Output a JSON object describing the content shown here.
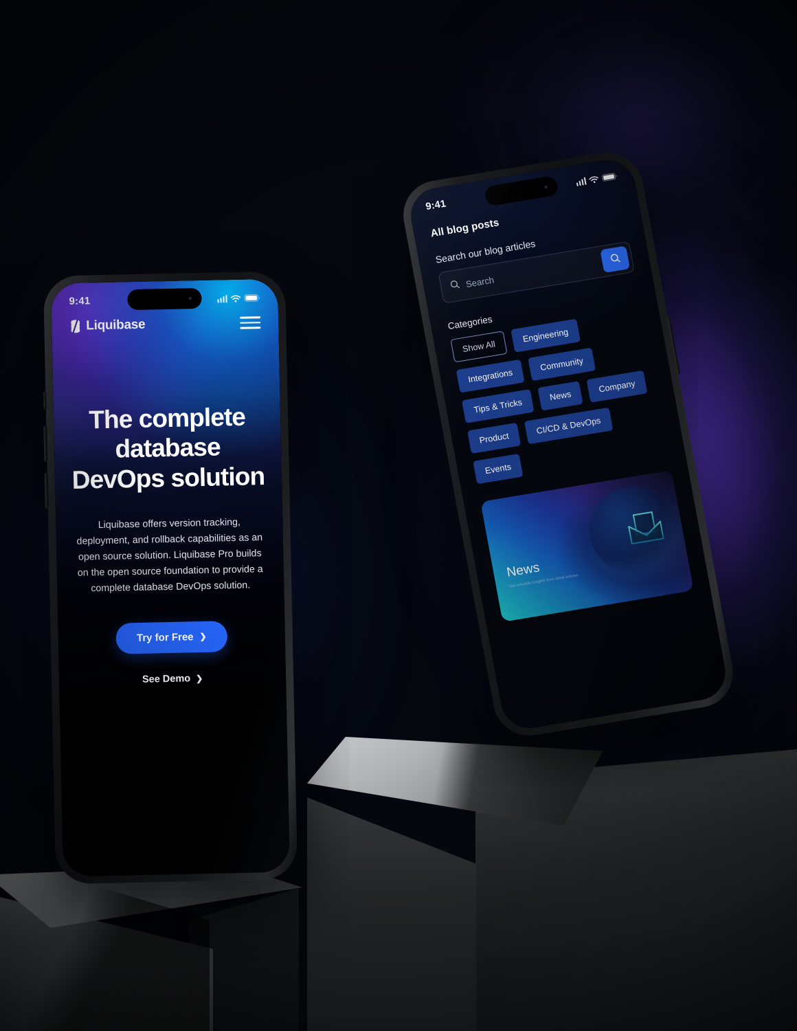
{
  "scene": {
    "background_color": "#05080f",
    "accent_purple": "#6e46e1",
    "accent_blue": "#2563f3"
  },
  "left_phone": {
    "status_bar": {
      "time": "9:41",
      "signal_icon": "cellular-signal-icon",
      "wifi_icon": "wifi-icon",
      "battery_icon": "battery-icon"
    },
    "header": {
      "logo_mark": "liquibase-logo-mark",
      "logo_text": "Liquibase",
      "menu_icon": "hamburger-menu-icon"
    },
    "hero": {
      "title": "The complete database DevOps solution",
      "body": "Liquibase offers version tracking, deployment, and rollback capabilities as an open source solution. Liquibase Pro builds on the open source foundation to provide a complete database DevOps solution.",
      "primary_cta": "Try for Free",
      "primary_cta_chevron": "chevron-right-icon",
      "secondary_cta": "See Demo",
      "secondary_cta_chevron": "chevron-right-icon",
      "gradient_from": "#4a20b4",
      "gradient_to": "#00b2eb"
    }
  },
  "right_phone": {
    "status_bar": {
      "time": "9:41",
      "signal_icon": "cellular-signal-icon",
      "wifi_icon": "wifi-icon",
      "battery_icon": "battery-icon"
    },
    "blog": {
      "page_title": "All blog posts",
      "search_label": "Search our blog articles",
      "search_placeholder": "Search",
      "search_value": "",
      "search_field_icon": "search-icon",
      "search_button_icon": "search-icon",
      "search_button_color": "#2b6bf5",
      "categories_label": "Categories",
      "categories": [
        {
          "label": "Show All",
          "style": "outline"
        },
        {
          "label": "Engineering",
          "style": "filled"
        },
        {
          "label": "Integrations",
          "style": "filled"
        },
        {
          "label": "Community",
          "style": "filled"
        },
        {
          "label": "Tips & Tricks",
          "style": "filled"
        },
        {
          "label": "News",
          "style": "filled"
        },
        {
          "label": "Company",
          "style": "filled"
        },
        {
          "label": "Product",
          "style": "filled"
        },
        {
          "label": "CI/CD & DevOps",
          "style": "filled"
        },
        {
          "label": "Events",
          "style": "filled"
        }
      ],
      "promo_card": {
        "title": "News",
        "subtitle": "Get valuable insights from latest articles",
        "icon": "envelope-document-icon"
      }
    }
  }
}
